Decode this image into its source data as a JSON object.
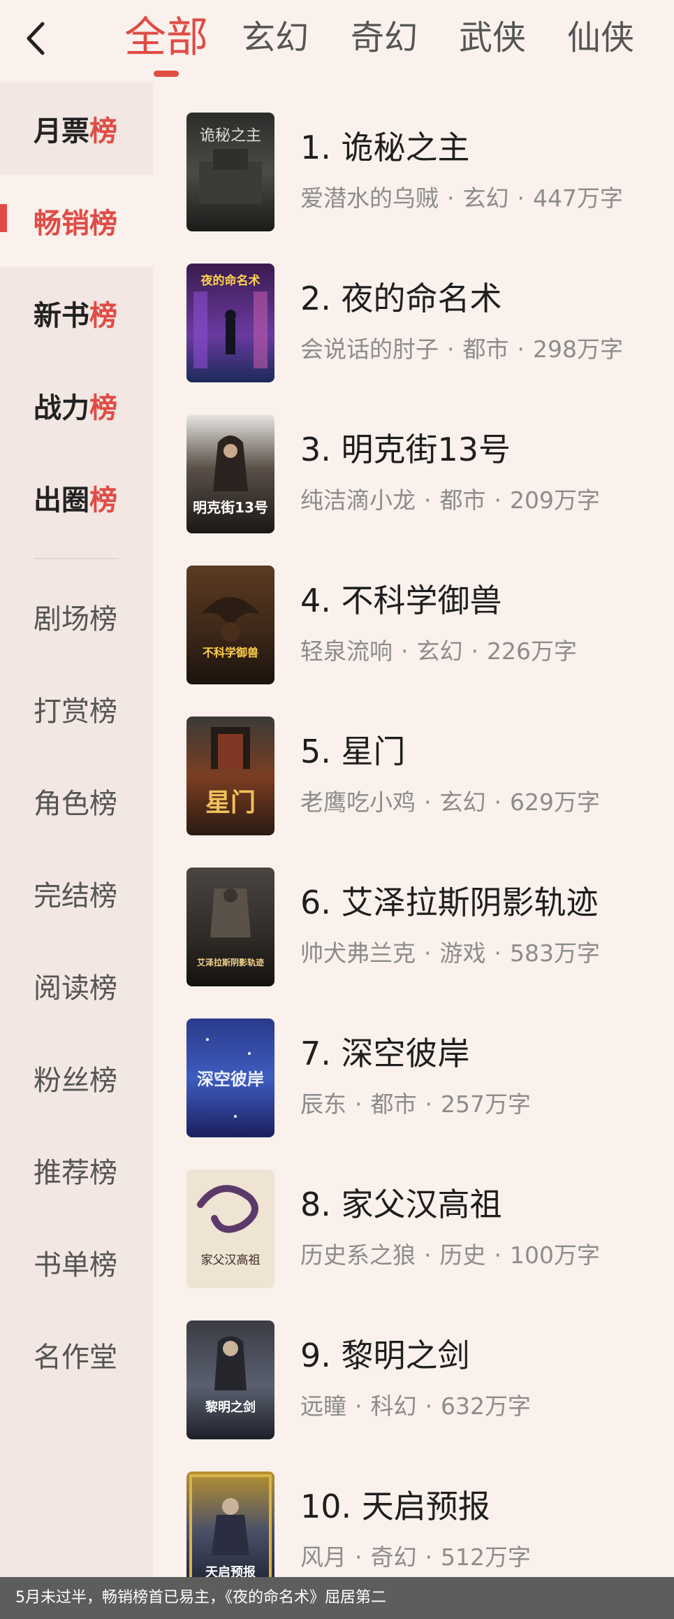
{
  "header": {
    "back_icon": "chevron-left-icon",
    "tabs": [
      "全部",
      "玄幻",
      "奇幻",
      "武侠",
      "仙侠"
    ],
    "active_tab": 0
  },
  "sidebar": {
    "primary": [
      {
        "lead": "月票",
        "tail": "榜"
      },
      {
        "lead": "畅销",
        "tail": "榜"
      },
      {
        "lead": "新书",
        "tail": "榜"
      },
      {
        "lead": "战力",
        "tail": "榜"
      },
      {
        "lead": "出圈",
        "tail": "榜"
      }
    ],
    "active_index": 1,
    "secondary": [
      "剧场榜",
      "打赏榜",
      "角色榜",
      "完结榜",
      "阅读榜",
      "粉丝榜",
      "推荐榜",
      "书单榜",
      "名作堂"
    ]
  },
  "books": [
    {
      "title": "1. 诡秘之主",
      "author": "爱潜水的乌贼",
      "genre": "玄幻",
      "words": "447万字",
      "cover_text": "诡秘之主"
    },
    {
      "title": "2. 夜的命名术",
      "author": "会说话的肘子",
      "genre": "都市",
      "words": "298万字",
      "cover_text": "夜的命名术"
    },
    {
      "title": "3. 明克街13号",
      "author": "纯洁滴小龙",
      "genre": "都市",
      "words": "209万字",
      "cover_text": "明克街13号"
    },
    {
      "title": "4. 不科学御兽",
      "author": "轻泉流响",
      "genre": "玄幻",
      "words": "226万字",
      "cover_text": "不科学御兽"
    },
    {
      "title": "5. 星门",
      "author": "老鹰吃小鸡",
      "genre": "玄幻",
      "words": "629万字",
      "cover_text": "星门"
    },
    {
      "title": "6. 艾泽拉斯阴影轨迹",
      "author": "帅犬弗兰克",
      "genre": "游戏",
      "words": "583万字",
      "cover_text": "艾泽拉斯阴影轨迹"
    },
    {
      "title": "7. 深空彼岸",
      "author": "辰东",
      "genre": "都市",
      "words": "257万字",
      "cover_text": "深空彼岸"
    },
    {
      "title": "8. 家父汉高祖",
      "author": "历史系之狼",
      "genre": "历史",
      "words": "100万字",
      "cover_text": "家父汉高祖"
    },
    {
      "title": "9. 黎明之剑",
      "author": "远瞳",
      "genre": "科幻",
      "words": "632万字",
      "cover_text": "黎明之剑"
    },
    {
      "title": "10. 天启预报",
      "author": "风月",
      "genre": "奇幻",
      "words": "512万字",
      "cover_text": "天启预报"
    }
  ],
  "caption": "5月未过半，畅销榜首已易主，《夜的命名术》屈居第二",
  "colors": {
    "accent": "#e04b45",
    "background": "#faf1ec",
    "sidebar": "#f2e7e2"
  }
}
